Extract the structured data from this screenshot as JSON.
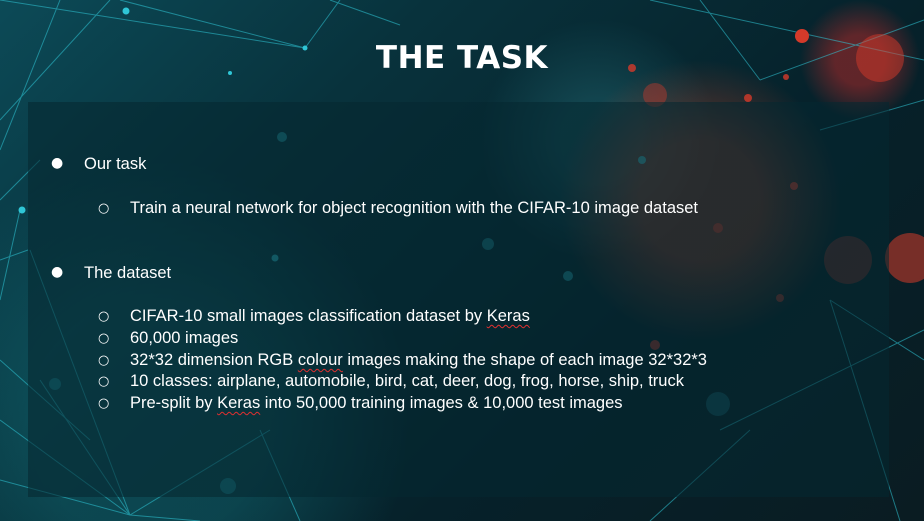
{
  "slide": {
    "title": "THE TASK",
    "sections": [
      {
        "heading": "Our task",
        "items": [
          {
            "text": "Train a neural network for object recognition with the CIFAR-10 image dataset"
          }
        ]
      },
      {
        "heading": "The dataset",
        "items": [
          {
            "pre": "CIFAR-10 small images classification dataset by ",
            "flagged": "Keras",
            "post": ""
          },
          {
            "pre": "60,000 images",
            "flagged": "",
            "post": ""
          },
          {
            "pre": "32*32 dimension RGB ",
            "flagged": "colour",
            "post": " images making the shape of each image 32*32*3"
          },
          {
            "pre": "10 classes: airplane, automobile, bird, cat, deer, dog, frog, horse, ship, truck",
            "flagged": "",
            "post": ""
          },
          {
            "pre": "Pre-split by ",
            "flagged": "Keras",
            "post": " into 50,000 training images & 10,000 test images"
          }
        ]
      }
    ]
  },
  "colors": {
    "text": "#ffffff",
    "panel": "#05282f",
    "network_lines": "#2fc6d6",
    "spellcheck_underline": "#e03030"
  }
}
